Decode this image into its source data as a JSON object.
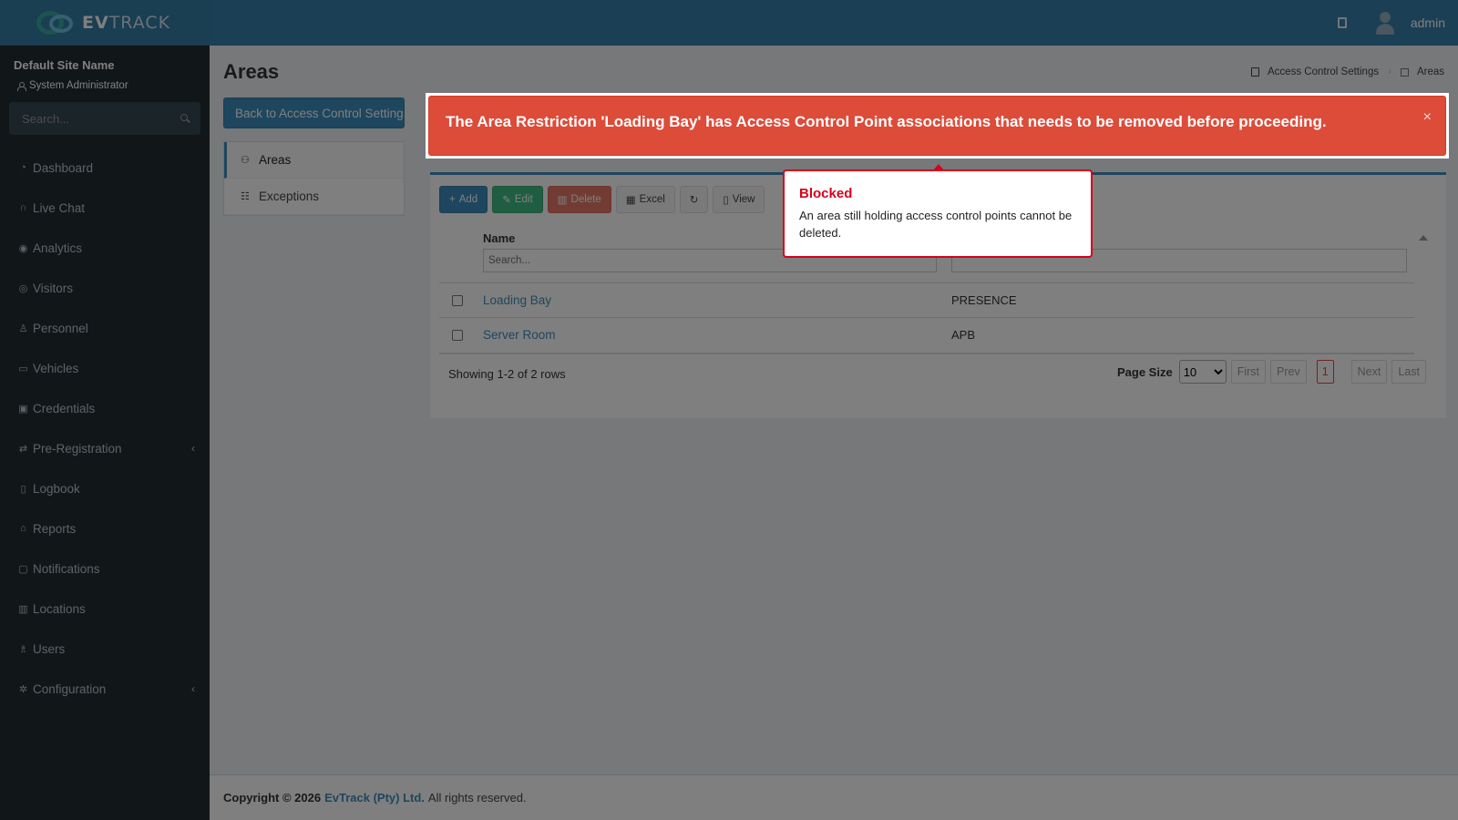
{
  "header": {
    "logo_prefix": "EV",
    "logo_suffix": "TRACK",
    "user_name": "admin"
  },
  "sidebar": {
    "site_name": "Default Site Name",
    "role": "System Administrator",
    "search_placeholder": "Search...",
    "items": [
      {
        "label": "Dashboard"
      },
      {
        "label": "Live Chat"
      },
      {
        "label": "Analytics"
      },
      {
        "label": "Visitors"
      },
      {
        "label": "Personnel"
      },
      {
        "label": "Vehicles"
      },
      {
        "label": "Credentials"
      },
      {
        "label": "Pre-Registration"
      },
      {
        "label": "Logbook"
      },
      {
        "label": "Reports"
      },
      {
        "label": "Notifications"
      },
      {
        "label": "Locations"
      },
      {
        "label": "Users"
      },
      {
        "label": "Configuration"
      }
    ]
  },
  "page": {
    "title": "Areas",
    "breadcrumb": [
      "Access Control Settings",
      "Areas"
    ],
    "back_button": "Back to Access Control Settings",
    "subnav": [
      "Areas",
      "Exceptions"
    ]
  },
  "toolbar": {
    "add": "Add",
    "edit": "Edit",
    "delete": "Delete",
    "excel": "Excel",
    "view": "View"
  },
  "table": {
    "col_name": "Name",
    "search_placeholder": "Search...",
    "rows": [
      {
        "name": "Loading Bay",
        "type": "PRESENCE"
      },
      {
        "name": "Server Room",
        "type": "APB"
      }
    ],
    "showing": "Showing 1-2 of 2 rows",
    "page_size_label": "Page Size",
    "page_size": "10",
    "pager": {
      "first": "First",
      "prev": "Prev",
      "current": "1",
      "next": "Next",
      "last": "Last"
    }
  },
  "footer": {
    "copyright": "Copyright © 2026",
    "company": "EvTrack (Pty) Ltd.",
    "rights": "All rights reserved."
  },
  "alert": {
    "message": "The Area Restriction 'Loading Bay' has Access Control Point associations that needs to be removed before proceeding.",
    "close": "×"
  },
  "popover": {
    "title": "Blocked",
    "body": "An area still holding access control points cannot be deleted."
  },
  "colors": {
    "header": "#367fa9",
    "sidebar": "#222d32",
    "alert": "#dd4b39",
    "popover_border": "#d9001b"
  }
}
